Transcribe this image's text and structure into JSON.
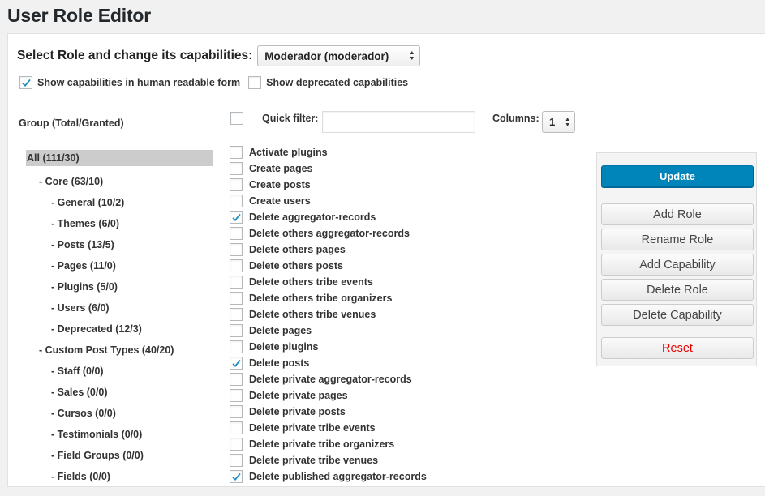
{
  "page_title": "User Role Editor",
  "role_select": {
    "label": "Select Role and change its capabilities:",
    "value": "Moderador (moderador)"
  },
  "options": [
    {
      "label": "Show capabilities in human readable form",
      "checked": true
    },
    {
      "label": "Show deprecated capabilities",
      "checked": false
    }
  ],
  "group_header": "Group (Total/Granted)",
  "quick_filter": {
    "label": "Quick filter:",
    "value": ""
  },
  "columns": {
    "label": "Columns:",
    "value": "1"
  },
  "groups": [
    {
      "label": "All (111/30)",
      "selected": true,
      "indent": 0
    },
    {
      "label": "- Core (63/10)",
      "indent": 1
    },
    {
      "label": "- General (10/2)",
      "indent": 2
    },
    {
      "label": "- Themes (6/0)",
      "indent": 2
    },
    {
      "label": "- Posts (13/5)",
      "indent": 2
    },
    {
      "label": "- Pages (11/0)",
      "indent": 2
    },
    {
      "label": "- Plugins (5/0)",
      "indent": 2
    },
    {
      "label": "- Users (6/0)",
      "indent": 2
    },
    {
      "label": "- Deprecated (12/3)",
      "indent": 2
    },
    {
      "label": "- Custom Post Types (40/20)",
      "indent": 1
    },
    {
      "label": "- Staff (0/0)",
      "indent": 2
    },
    {
      "label": "- Sales (0/0)",
      "indent": 2
    },
    {
      "label": "- Cursos (0/0)",
      "indent": 2
    },
    {
      "label": "- Testimonials (0/0)",
      "indent": 2
    },
    {
      "label": "- Field Groups (0/0)",
      "indent": 2
    },
    {
      "label": "- Fields (0/0)",
      "indent": 2
    }
  ],
  "capabilities": [
    {
      "label": "Activate plugins",
      "checked": false
    },
    {
      "label": "Create pages",
      "checked": false
    },
    {
      "label": "Create posts",
      "checked": false
    },
    {
      "label": "Create users",
      "checked": false
    },
    {
      "label": "Delete aggregator-records",
      "checked": true
    },
    {
      "label": "Delete others aggregator-records",
      "checked": false
    },
    {
      "label": "Delete others pages",
      "checked": false
    },
    {
      "label": "Delete others posts",
      "checked": false
    },
    {
      "label": "Delete others tribe events",
      "checked": false
    },
    {
      "label": "Delete others tribe organizers",
      "checked": false
    },
    {
      "label": "Delete others tribe venues",
      "checked": false
    },
    {
      "label": "Delete pages",
      "checked": false
    },
    {
      "label": "Delete plugins",
      "checked": false
    },
    {
      "label": "Delete posts",
      "checked": true
    },
    {
      "label": "Delete private aggregator-records",
      "checked": false
    },
    {
      "label": "Delete private pages",
      "checked": false
    },
    {
      "label": "Delete private posts",
      "checked": false
    },
    {
      "label": "Delete private tribe events",
      "checked": false
    },
    {
      "label": "Delete private tribe organizers",
      "checked": false
    },
    {
      "label": "Delete private tribe venues",
      "checked": false
    },
    {
      "label": "Delete published aggregator-records",
      "checked": true
    }
  ],
  "actions": {
    "update": "Update",
    "add_role": "Add Role",
    "rename_role": "Rename Role",
    "add_capability": "Add Capability",
    "delete_role": "Delete Role",
    "delete_capability": "Delete Capability",
    "reset": "Reset"
  },
  "colors": {
    "primary": "#0085ba",
    "reset": "#ee0000",
    "check": "#1e8cbe"
  }
}
